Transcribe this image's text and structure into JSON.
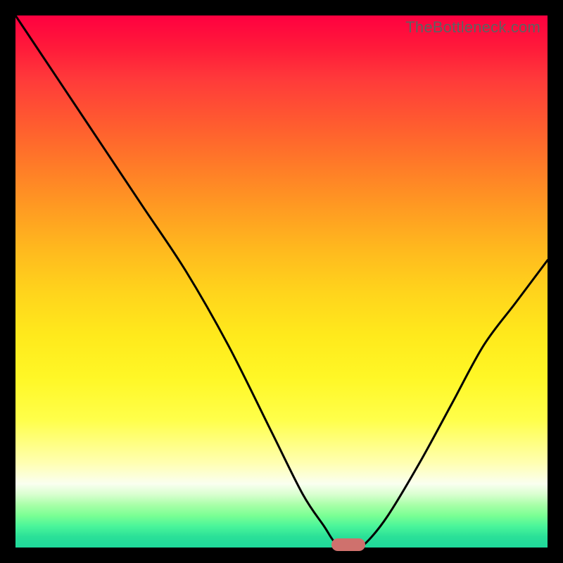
{
  "watermark": "TheBottleneck.com",
  "chart_data": {
    "type": "line",
    "title": "",
    "xlabel": "",
    "ylabel": "",
    "xlim": [
      0,
      100
    ],
    "ylim": [
      0,
      100
    ],
    "grid": false,
    "series": [
      {
        "name": "bottleneck-curve",
        "x": [
          0,
          8,
          16,
          24,
          32,
          40,
          48,
          54,
          58,
          60,
          62,
          64,
          66,
          70,
          76,
          82,
          88,
          94,
          100
        ],
        "values": [
          100,
          88,
          76,
          64,
          52,
          38,
          22,
          10,
          4,
          1,
          0,
          0,
          1,
          6,
          16,
          27,
          38,
          46,
          54
        ]
      }
    ],
    "marker": {
      "x": 62.5,
      "y": 0.5
    },
    "colors": {
      "top": "#ff0040",
      "mid": "#ffd41c",
      "bottom": "#1fd99b",
      "curve": "#000000",
      "marker": "#cf716d"
    }
  }
}
